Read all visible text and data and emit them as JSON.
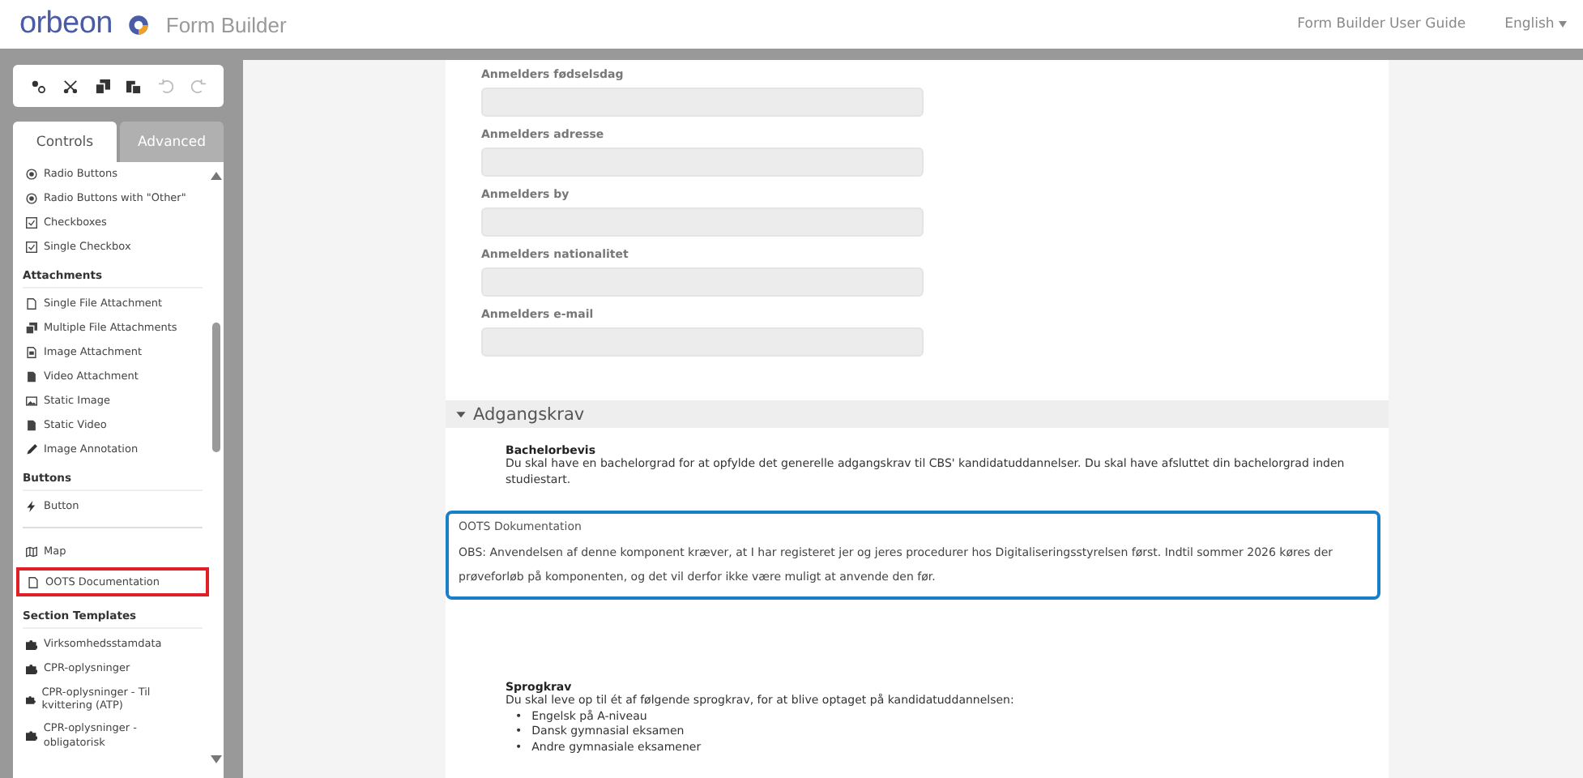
{
  "header": {
    "logo": "orbeon",
    "product": "Form Builder",
    "links": [
      {
        "label": "Form Builder User Guide"
      }
    ],
    "language": "English"
  },
  "toolbar": {
    "tools": [
      {
        "kind": "gears",
        "disabled": false
      },
      {
        "kind": "cut",
        "disabled": false
      },
      {
        "kind": "copy",
        "disabled": false
      },
      {
        "kind": "paste",
        "disabled": false
      },
      {
        "kind": "undo",
        "disabled": true
      },
      {
        "kind": "redo",
        "disabled": true
      }
    ]
  },
  "tabs": [
    {
      "label": "Controls",
      "selected": true
    },
    {
      "label": "Advanced",
      "selected": false
    }
  ],
  "sidebar": {
    "items": [
      {
        "kind": "radio",
        "label": "Radio Buttons",
        "highlighted": false
      },
      {
        "kind": "radio",
        "label": "Radio Buttons with \"Other\"",
        "highlighted": false
      },
      {
        "kind": "checkbox",
        "label": "Checkboxes",
        "highlighted": false
      },
      {
        "kind": "checkbox",
        "label": "Single Checkbox",
        "highlighted": false
      },
      {
        "kind": "heading",
        "label": "Attachments"
      },
      {
        "kind": "file",
        "label": "Single File Attachment",
        "highlighted": false
      },
      {
        "kind": "files",
        "label": "Multiple File Attachments",
        "highlighted": false
      },
      {
        "kind": "image",
        "label": "Image Attachment",
        "highlighted": false
      },
      {
        "kind": "video",
        "label": "Video Attachment",
        "highlighted": false
      },
      {
        "kind": "picture",
        "label": "Static Image",
        "highlighted": false
      },
      {
        "kind": "video",
        "label": "Static Video",
        "highlighted": false
      },
      {
        "kind": "pen",
        "label": "Image Annotation",
        "highlighted": false
      },
      {
        "kind": "heading",
        "label": "Buttons"
      },
      {
        "kind": "bolt",
        "label": "Button",
        "highlighted": false
      },
      {
        "kind": "divider"
      },
      {
        "kind": "map",
        "label": "Map",
        "highlighted": false
      },
      {
        "kind": "file",
        "label": "OOTS Documentation",
        "highlighted": true
      },
      {
        "kind": "heading",
        "label": "Section Templates"
      },
      {
        "kind": "puzzle",
        "label": "Virksomhedsstamdata",
        "highlighted": false
      },
      {
        "kind": "puzzle",
        "label": "CPR-oplysninger",
        "highlighted": false
      },
      {
        "kind": "puzzle",
        "label": "CPR-oplysninger - Til kvittering (ATP)",
        "highlighted": false
      },
      {
        "kind": "puzzle",
        "label": "CPR-oplysninger - obligatorisk",
        "highlighted": false
      }
    ]
  },
  "form": {
    "fields": [
      {
        "label": "Anmelders fødselsdag"
      },
      {
        "label": "Anmelders adresse"
      },
      {
        "label": "Anmelders by"
      },
      {
        "label": "Anmelders nationalitet"
      },
      {
        "label": "Anmelders e-mail"
      }
    ],
    "section": {
      "title": "Adgangskrav",
      "expanded": true,
      "blocks": [
        {
          "kind": "text",
          "title": "Bachelorbevis",
          "body": "Du skal have en bachelorgrad for at opfylde det generelle adgangskrav til CBS' kandidatuddannelser. Du skal have afsluttet din bachelorgrad inden studiestart."
        },
        {
          "kind": "notice",
          "selected": true,
          "title": "OOTS Dokumentation",
          "body": "OBS: Anvendelsen af denne komponent kræver, at I har registeret jer og jeres procedurer hos Digitaliseringsstyrelsen først. Indtil sommer 2026 køres der prøveforløb på komponenten, og det vil derfor ikke være muligt at anvende den før."
        },
        {
          "kind": "text",
          "title": "Sprogkrav",
          "body": "Du skal leve op til ét af følgende sprogkrav, for at blive optaget på kandidatuddannelsen:",
          "bullets": [
            {
              "marker": "•",
              "text": "Engelsk på A-niveau"
            },
            {
              "marker": "•",
              "text": "Dansk gymnasial eksamen"
            },
            {
              "marker": "•",
              "text": "Andre gymnasiale eksamener"
            }
          ]
        }
      ]
    }
  }
}
